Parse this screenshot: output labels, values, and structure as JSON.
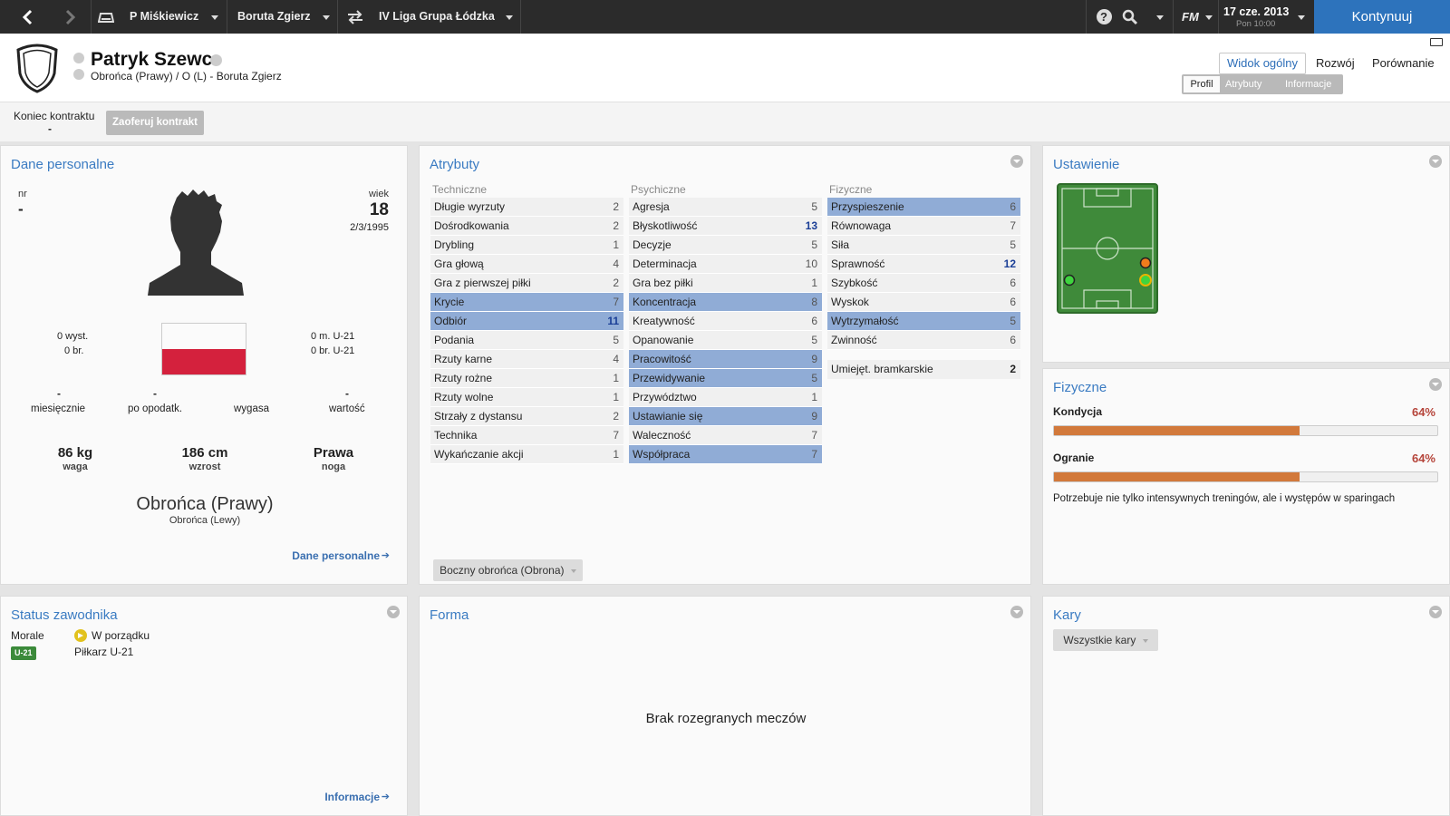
{
  "topbar": {
    "manager": "P Miśkiewicz",
    "club": "Boruta Zgierz",
    "league": "IV Liga Grupa Łódzka",
    "fm_logo": "FM",
    "date": "17 cze. 2013",
    "day_time": "Pon 10:00",
    "continue_label": "Kontynuuj"
  },
  "player": {
    "name": "Patryk Szewc",
    "subtitle": "Obrońca (Prawy) / O (L) - Boruta Zgierz"
  },
  "views": {
    "overview": "Widok ogólny",
    "development": "Rozwój",
    "comparison": "Porównanie"
  },
  "subtabs": [
    "Profil",
    "Atrybuty",
    "Informacje"
  ],
  "contract": {
    "label": "Koniec kontraktu",
    "value": "-",
    "offer_button": "Zaoferuj kontrakt"
  },
  "personal": {
    "title": "Dane personalne",
    "nr_label": "nr",
    "nr_value": "-",
    "age_label": "wiek",
    "age_value": "18",
    "dob": "2/3/1995",
    "apps": "0 wyst.",
    "goals": "0 br.",
    "u21_apps": "0 m. U-21",
    "u21_goals": "0 br. U-21",
    "wage_value": "-",
    "wage_label": "miesięcznie",
    "tax_value": "-",
    "tax_label": "po opodatk.",
    "expires_label": "wygasa",
    "value_value": "-",
    "value_label": "wartość",
    "weight": "86 kg",
    "weight_label": "waga",
    "height": "186 cm",
    "height_label": "wzrost",
    "foot": "Prawa",
    "foot_label": "noga",
    "position_main": "Obrońca (Prawy)",
    "position_secondary": "Obrońca (Lewy)",
    "link": "Dane personalne"
  },
  "attributes": {
    "title": "Atrybuty",
    "technical_label": "Techniczne",
    "mental_label": "Psychiczne",
    "physical_label": "Fizyczne",
    "technical": [
      {
        "name": "Długie wyrzuty",
        "value": 2,
        "hl": false
      },
      {
        "name": "Dośrodkowania",
        "value": 2,
        "hl": false
      },
      {
        "name": "Drybling",
        "value": 1,
        "hl": false
      },
      {
        "name": "Gra głową",
        "value": 4,
        "hl": false
      },
      {
        "name": "Gra z pierwszej piłki",
        "value": 2,
        "hl": false
      },
      {
        "name": "Krycie",
        "value": 7,
        "hl": true
      },
      {
        "name": "Odbiór",
        "value": 11,
        "hl": true
      },
      {
        "name": "Podania",
        "value": 5,
        "hl": false
      },
      {
        "name": "Rzuty karne",
        "value": 4,
        "hl": false
      },
      {
        "name": "Rzuty rożne",
        "value": 1,
        "hl": false
      },
      {
        "name": "Rzuty wolne",
        "value": 1,
        "hl": false
      },
      {
        "name": "Strzały z dystansu",
        "value": 2,
        "hl": false
      },
      {
        "name": "Technika",
        "value": 7,
        "hl": false
      },
      {
        "name": "Wykańczanie akcji",
        "value": 1,
        "hl": false
      }
    ],
    "mental": [
      {
        "name": "Agresja",
        "value": 5,
        "hl": false
      },
      {
        "name": "Błyskotliwość",
        "value": 13,
        "hl": false
      },
      {
        "name": "Decyzje",
        "value": 5,
        "hl": false
      },
      {
        "name": "Determinacja",
        "value": 10,
        "hl": false
      },
      {
        "name": "Gra bez piłki",
        "value": 1,
        "hl": false
      },
      {
        "name": "Koncentracja",
        "value": 8,
        "hl": true
      },
      {
        "name": "Kreatywność",
        "value": 6,
        "hl": false
      },
      {
        "name": "Opanowanie",
        "value": 5,
        "hl": false
      },
      {
        "name": "Pracowitość",
        "value": 9,
        "hl": true
      },
      {
        "name": "Przewidywanie",
        "value": 5,
        "hl": true
      },
      {
        "name": "Przywództwo",
        "value": 1,
        "hl": false
      },
      {
        "name": "Ustawianie się",
        "value": 9,
        "hl": true
      },
      {
        "name": "Waleczność",
        "value": 7,
        "hl": false
      },
      {
        "name": "Współpraca",
        "value": 7,
        "hl": true
      }
    ],
    "physical": [
      {
        "name": "Przyspieszenie",
        "value": 6,
        "hl": true
      },
      {
        "name": "Równowaga",
        "value": 7,
        "hl": false
      },
      {
        "name": "Siła",
        "value": 5,
        "hl": false
      },
      {
        "name": "Sprawność",
        "value": 12,
        "hl": false
      },
      {
        "name": "Szybkość",
        "value": 6,
        "hl": false
      },
      {
        "name": "Wyskok",
        "value": 6,
        "hl": false
      },
      {
        "name": "Wytrzymałość",
        "value": 5,
        "hl": true
      },
      {
        "name": "Zwinność",
        "value": 6,
        "hl": false
      }
    ],
    "goalkeeping": {
      "name": "Umiejęt. bramkarskie",
      "value": 2
    },
    "role_button": "Boczny obrońca (Obrona)"
  },
  "position": {
    "title": "Ustawienie"
  },
  "fitness": {
    "title": "Fizyczne",
    "condition_label": "Kondycja",
    "condition_value": "64%",
    "condition_fraction": 0.64,
    "match_label": "Ogranie",
    "match_value": "64%",
    "match_fraction": 0.64,
    "note": "Potrzebuje nie tylko intensywnych treningów, ale i występów w sparingach"
  },
  "status": {
    "title": "Status zawodnika",
    "morale_label": "Morale",
    "morale_value": "W porządku",
    "badge": "U-21",
    "badge_text": "Piłkarz U-21",
    "link": "Informacje"
  },
  "form": {
    "title": "Forma",
    "empty": "Brak rozegranych meczów"
  },
  "bans": {
    "title": "Kary",
    "button": "Wszystkie kary"
  },
  "colors": {
    "accent": "#3a7bc2",
    "continue": "#2d73bc",
    "highlight": "#90acd6",
    "bar": "#d2793b",
    "pitch": "#3f8a3a"
  }
}
